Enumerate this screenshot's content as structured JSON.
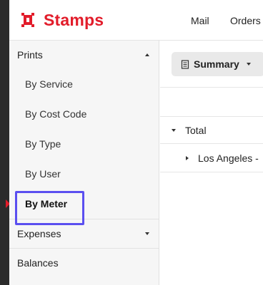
{
  "brand": {
    "name": "Stamps",
    "color": "#e21c2a",
    "icon": "stamp-logo-icon"
  },
  "nav": {
    "mail": "Mail",
    "orders": "Orders"
  },
  "sidebar": {
    "prints": {
      "label": "Prints",
      "expanded": true,
      "items": [
        "By Service",
        "By Cost Code",
        "By Type",
        "By User",
        "By Meter"
      ],
      "active_item": "By Meter"
    },
    "expenses": {
      "label": "Expenses",
      "expanded": false
    },
    "balances": {
      "label": "Balances"
    }
  },
  "toolbar": {
    "summary_label": "Summary",
    "summary_icon": "document-icon"
  },
  "report": {
    "total_label": "Total",
    "child_label": "Los Angeles -"
  },
  "colors": {
    "highlight": "#5b4ff0",
    "sidebar_bg": "#f6f6f6"
  }
}
